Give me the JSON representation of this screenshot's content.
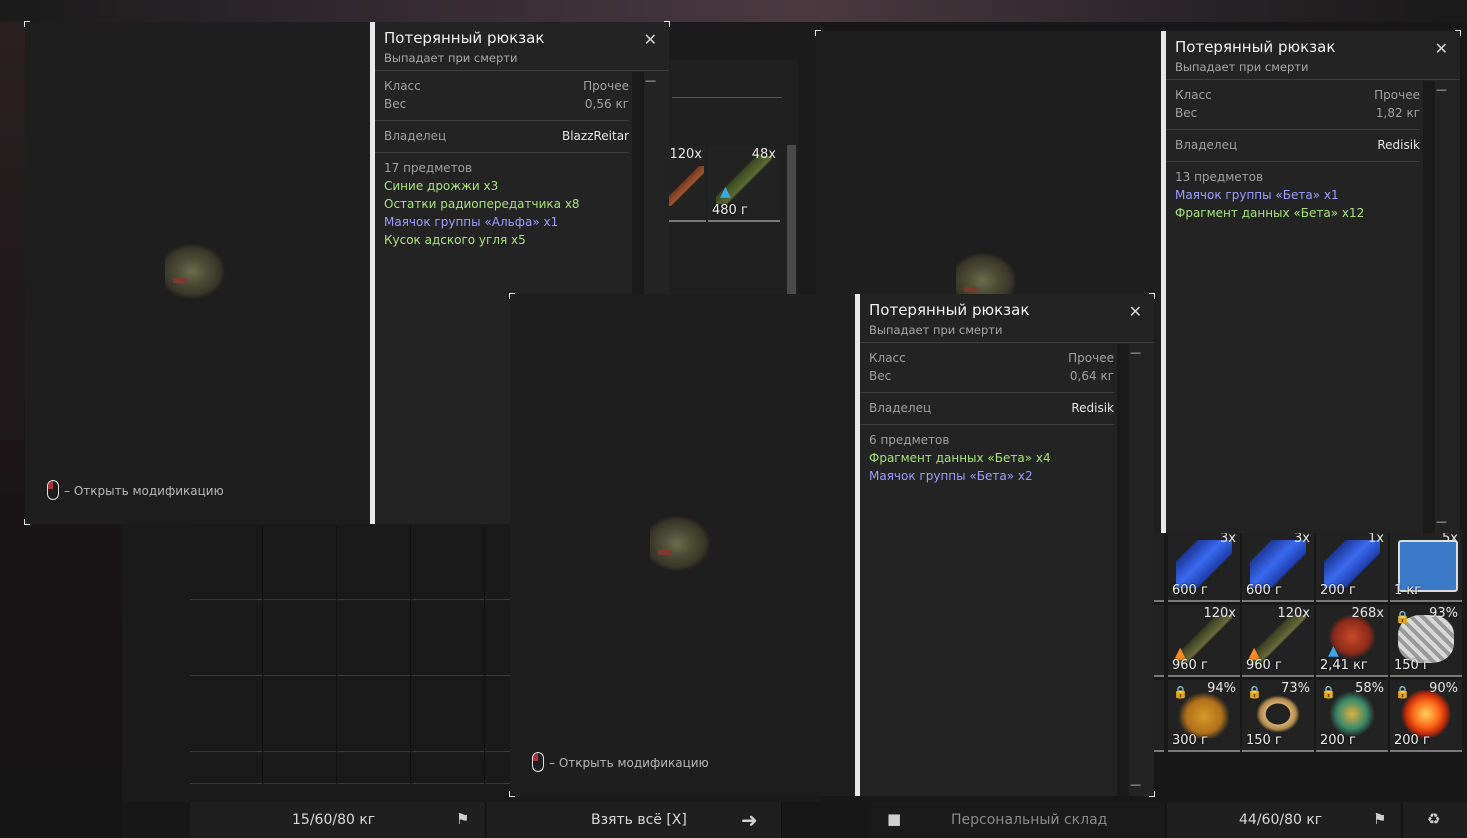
{
  "popups": [
    {
      "title": "Потерянный рюкзак",
      "subtitle": "Выпадает при смерти",
      "class_label": "Класс",
      "class_value": "Прочее",
      "weight_label": "Вес",
      "weight_value": "0,56 кг",
      "owner_label": "Владелец",
      "owner_value": "BlazzReitar",
      "items_count": "17 предметов",
      "items": [
        {
          "text": "Синие дрожжи x3",
          "color": "green"
        },
        {
          "text": "Остатки радиопередатчика x8",
          "color": "green"
        },
        {
          "text": "Маячок группы «Альфа» x1",
          "color": "purple"
        },
        {
          "text": "Кусок адского угля x5",
          "color": "green"
        }
      ],
      "mod_hint": "– Открыть модификацию"
    },
    {
      "title": "Потерянный рюкзак",
      "subtitle": "Выпадает при смерти",
      "class_label": "Класс",
      "class_value": "Прочее",
      "weight_label": "Вес",
      "weight_value": "1,82 кг",
      "owner_label": "Владелец",
      "owner_value": "Redisik",
      "items_count": "13 предметов",
      "items": [
        {
          "text": "Маячок группы «Бета» x1",
          "color": "purple"
        },
        {
          "text": "Фрагмент данных «Бета» x12",
          "color": "green"
        }
      ]
    },
    {
      "title": "Потерянный рюкзак",
      "subtitle": "Выпадает при смерти",
      "class_label": "Класс",
      "class_value": "Прочее",
      "weight_label": "Вес",
      "weight_value": "0,64 кг",
      "owner_label": "Владелец",
      "owner_value": "Redisik",
      "items_count": "6 предметов",
      "items": [
        {
          "text": "Фрагмент данных «Бета» x4",
          "color": "green"
        },
        {
          "text": "Маячок группы «Бета» x2",
          "color": "purple"
        }
      ],
      "mod_hint": "– Открыть модификацию"
    }
  ],
  "middle_items": [
    {
      "count": "120x",
      "weight": ""
    },
    {
      "count": "48x",
      "weight": "480 г"
    }
  ],
  "right_items": [
    {
      "count": "3x",
      "weight": "600 г",
      "kind": "canister",
      "lock": false
    },
    {
      "count": "3x",
      "weight": "600 г",
      "kind": "canister",
      "lock": false
    },
    {
      "count": "1x",
      "weight": "200 г",
      "kind": "canister",
      "lock": false
    },
    {
      "count": "5x",
      "weight": "1 кг",
      "kind": "medkit",
      "lock": false
    },
    {
      "count": "120x",
      "weight": "960 г",
      "kind": "ammo-flame",
      "lock": false
    },
    {
      "count": "120x",
      "weight": "960 г",
      "kind": "ammo-flame",
      "lock": false
    },
    {
      "count": "268x",
      "weight": "2,41 кг",
      "kind": "shell",
      "lock": false
    },
    {
      "count": "93%",
      "weight": "150 г",
      "kind": "spiral",
      "lock": true
    },
    {
      "count": "94%",
      "weight": "300 г",
      "kind": "sponge",
      "lock": true
    },
    {
      "count": "73%",
      "weight": "150 г",
      "kind": "chain",
      "lock": true
    },
    {
      "count": "58%",
      "weight": "200 г",
      "kind": "orb",
      "lock": true
    },
    {
      "count": "90%",
      "weight": "200 г",
      "kind": "fire",
      "lock": true
    }
  ],
  "bottom_bar": {
    "left_weight": "15/60/80 кг",
    "take_all": "Взять всё [X]",
    "personal_storage": "Персональный склад",
    "right_weight": "44/60/80 кг"
  },
  "colors": {
    "green": "#a8e27a",
    "purple": "#9f9cff"
  }
}
